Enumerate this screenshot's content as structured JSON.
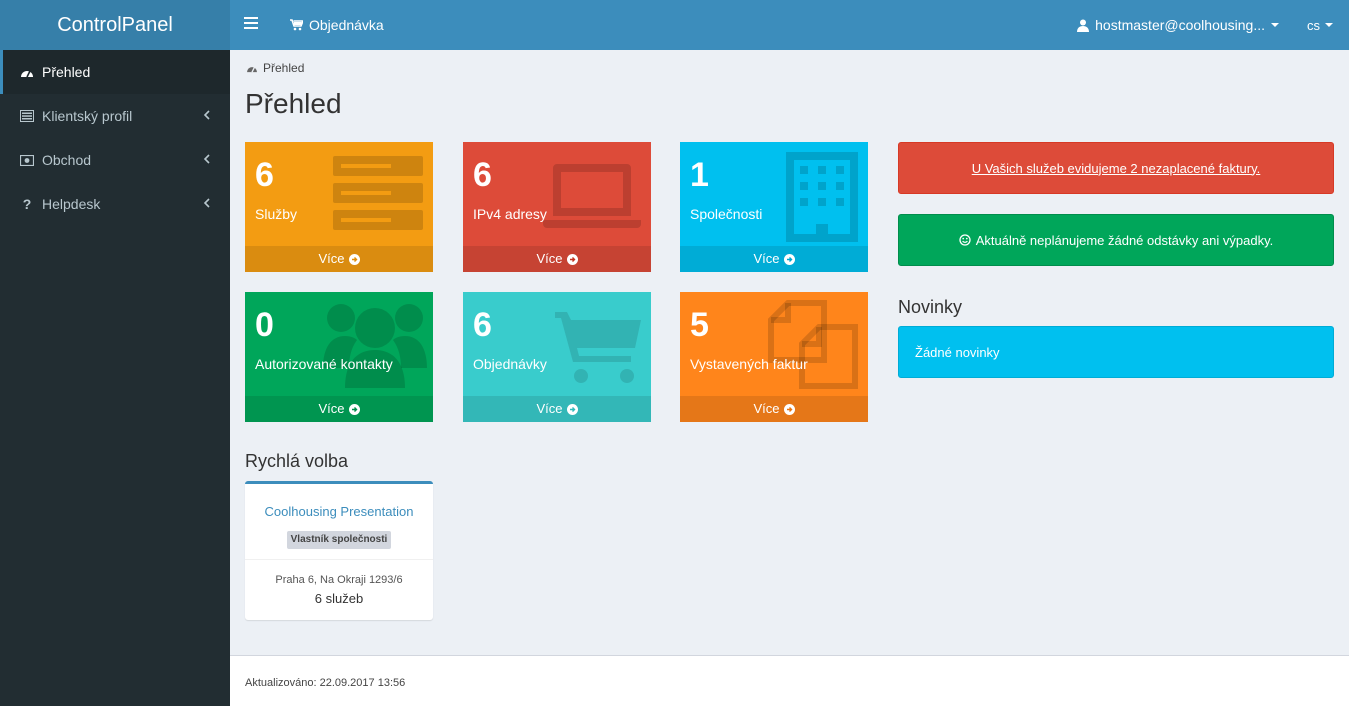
{
  "header": {
    "logo": "ControlPanel",
    "order_label": "Objednávka",
    "user": "hostmaster@coolhousing...",
    "lang": "cs"
  },
  "sidebar": {
    "items": [
      {
        "label": "Přehled",
        "icon": "dashboard-icon",
        "active": true
      },
      {
        "label": "Klientský profil",
        "icon": "list-icon"
      },
      {
        "label": "Obchod",
        "icon": "money-icon"
      },
      {
        "label": "Helpdesk",
        "icon": "question-icon"
      }
    ]
  },
  "breadcrumb": "Přehled",
  "page_title": "Přehled",
  "tiles": [
    {
      "value": "6",
      "label": "Služby",
      "more": "Více",
      "color": "#f39c12",
      "icon": "server-icon"
    },
    {
      "value": "6",
      "label": "IPv4 adresy",
      "more": "Více",
      "color": "#dd4b39",
      "icon": "laptop-icon"
    },
    {
      "value": "1",
      "label": "Společnosti",
      "more": "Více",
      "color": "#00c0ef",
      "icon": "building-icon"
    },
    {
      "value": "0",
      "label": "Autorizované kontakty",
      "more": "Více",
      "color": "#00a65a",
      "icon": "users-icon"
    },
    {
      "value": "6",
      "label": "Objednávky",
      "more": "Více",
      "color": "#39cccc",
      "icon": "cart-icon"
    },
    {
      "value": "5",
      "label": "Vystavených faktur",
      "more": "Více",
      "color": "#ff851b",
      "icon": "files-icon"
    }
  ],
  "alerts": {
    "unpaid": "U Vašich služeb evidujeme 2 nezaplacené faktury.",
    "outage": "Aktuálně neplánujeme žádné odstávky ani výpadky."
  },
  "news": {
    "title": "Novinky",
    "empty": "Žádné novinky"
  },
  "quick": {
    "title": "Rychlá volba",
    "company": "Coolhousing Presentation",
    "role": "Vlastník společnosti",
    "address": "Praha 6, Na Okraji 1293/6",
    "services": "6 služeb"
  },
  "footer": "Aktualizováno: 22.09.2017 13:56"
}
